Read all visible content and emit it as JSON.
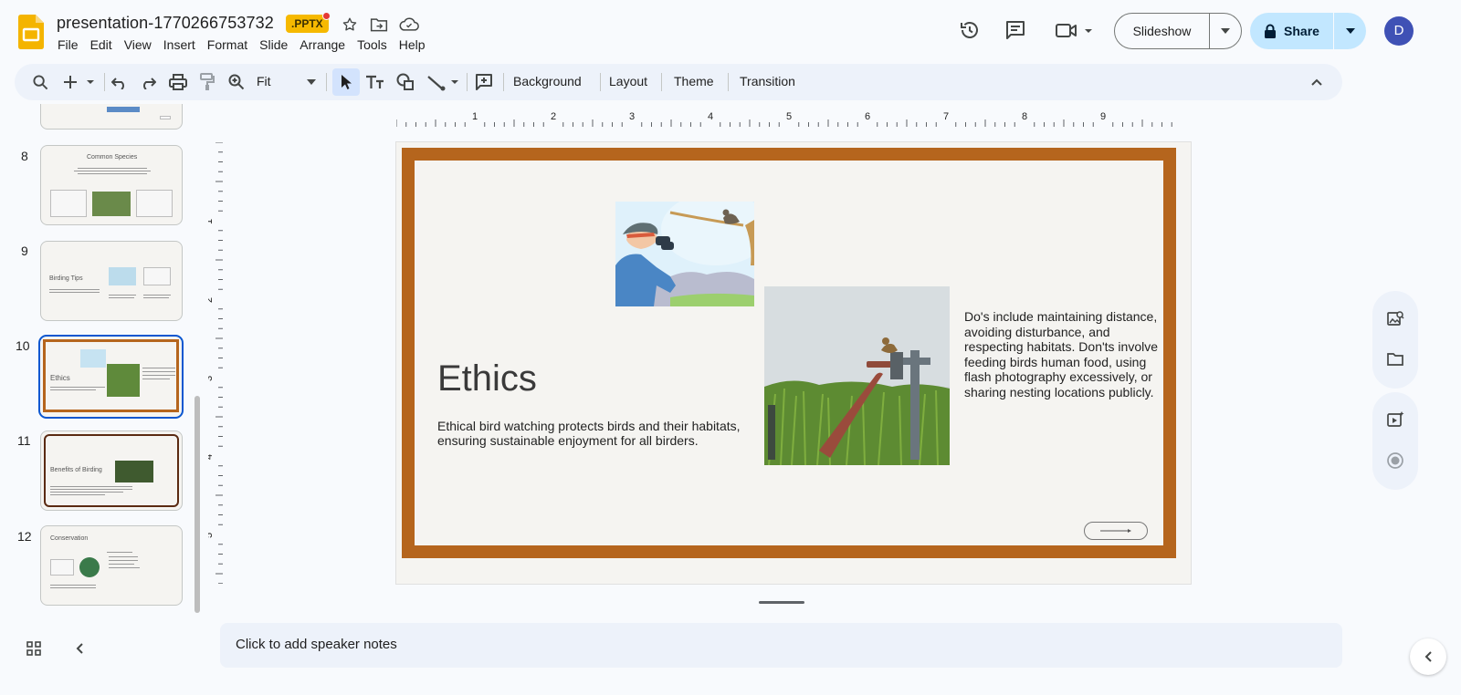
{
  "doc": {
    "title": "presentation-1770266753732",
    "badge": ".PPTX"
  },
  "menu": [
    "File",
    "Edit",
    "View",
    "Insert",
    "Format",
    "Slide",
    "Arrange",
    "Tools",
    "Help"
  ],
  "header": {
    "slideshow_label": "Slideshow",
    "share_label": "Share",
    "avatar_initial": "D"
  },
  "toolbar": {
    "zoom_label": "Fit",
    "background": "Background",
    "layout": "Layout",
    "theme": "Theme",
    "transition": "Transition"
  },
  "ruler": {
    "h_labels": [
      "1",
      "2",
      "3",
      "4",
      "5",
      "6",
      "7",
      "8",
      "9"
    ],
    "v_labels": [
      "1",
      "2",
      "3",
      "4",
      "5"
    ]
  },
  "filmstrip": {
    "slides": [
      {
        "num": "8",
        "title": "Common Species"
      },
      {
        "num": "9",
        "title": "Birding Tips"
      },
      {
        "num": "10",
        "title": "Ethics"
      },
      {
        "num": "11",
        "title": "Benefits of Birding"
      },
      {
        "num": "12",
        "title": "Conservation"
      }
    ]
  },
  "slide": {
    "title": "Ethics",
    "body": "Ethical bird watching protects birds and their habitats, ensuring sustainable enjoyment for all birders.",
    "side_text": "Do's include maintaining distance, avoiding disturbance, and respecting habitats. Don'ts involve feeding birds human food, using flash photography excessively, or sharing nesting locations publicly."
  },
  "notes": {
    "placeholder": "Click to add speaker notes"
  },
  "colors": {
    "accent": "#0b57d0",
    "frame": "#b5651d",
    "share_bg": "#c2e7ff",
    "badge": "#f6b900"
  }
}
